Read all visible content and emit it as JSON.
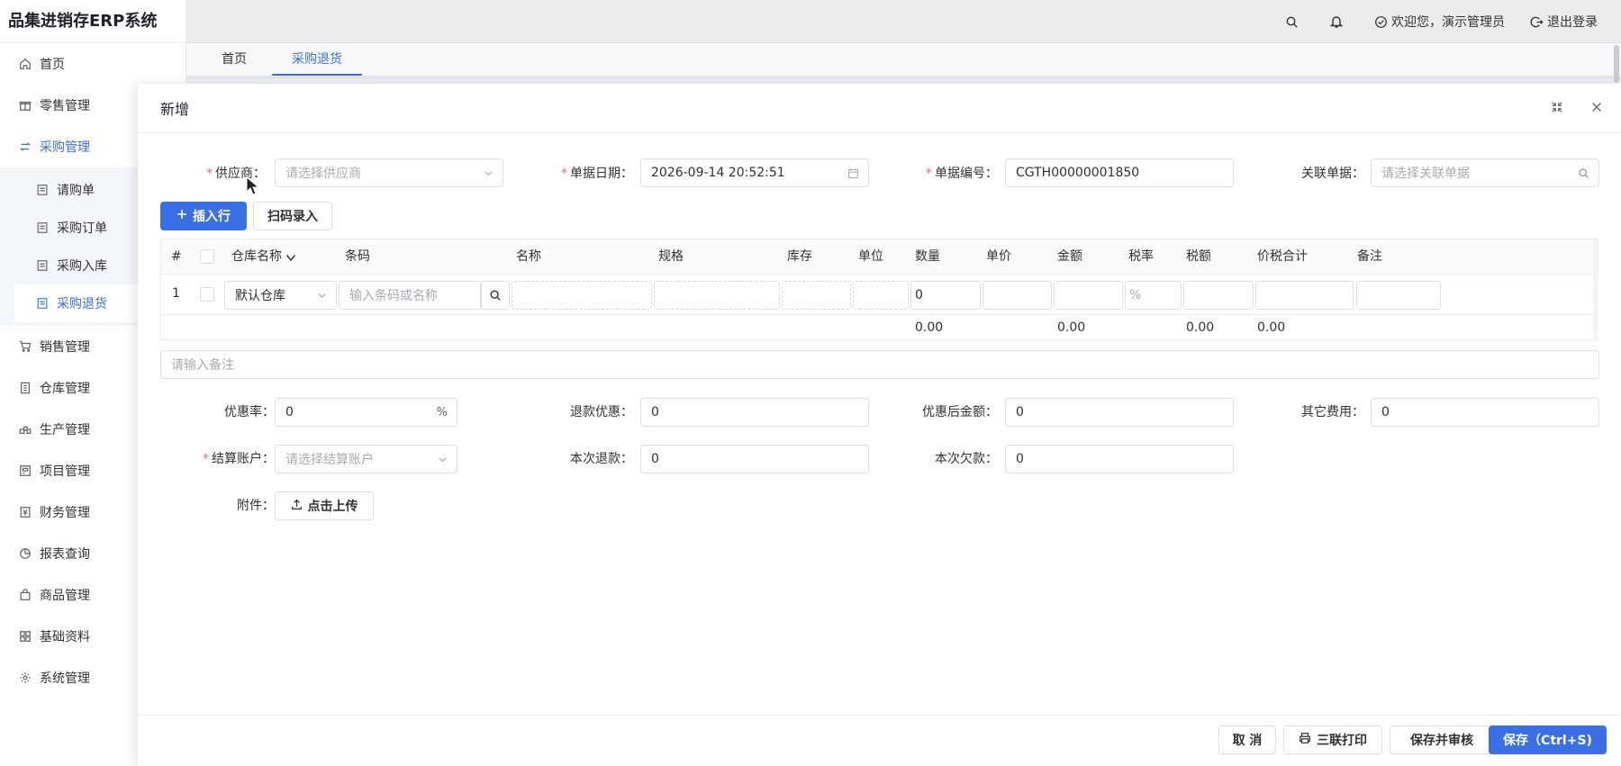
{
  "app": {
    "title": "品集进销存ERP系统"
  },
  "header": {
    "welcome": "欢迎您，演示管理员",
    "logout": "退出登录"
  },
  "sidebar": {
    "items": [
      {
        "label": "首页",
        "icon": "home-icon"
      },
      {
        "label": "零售管理",
        "icon": "gift-icon"
      },
      {
        "label": "采购管理",
        "icon": "swap-icon",
        "open": true,
        "children": [
          {
            "label": "请购单"
          },
          {
            "label": "采购订单"
          },
          {
            "label": "采购入库"
          },
          {
            "label": "采购退货",
            "active": true
          }
        ]
      },
      {
        "label": "销售管理",
        "icon": "cart-icon"
      },
      {
        "label": "仓库管理",
        "icon": "warehouse-icon"
      },
      {
        "label": "生产管理",
        "icon": "production-icon"
      },
      {
        "label": "项目管理",
        "icon": "project-icon"
      },
      {
        "label": "财务管理",
        "icon": "finance-icon"
      },
      {
        "label": "报表查询",
        "icon": "chart-icon"
      },
      {
        "label": "商品管理",
        "icon": "bag-icon"
      },
      {
        "label": "基础资料",
        "icon": "grid-icon"
      },
      {
        "label": "系统管理",
        "icon": "gear-icon"
      }
    ]
  },
  "tabs": [
    {
      "label": "首页"
    },
    {
      "label": "采购退货",
      "active": true
    }
  ],
  "drawer": {
    "title": "新增",
    "supplier": {
      "label": "供应商",
      "placeholder": "请选择供应商"
    },
    "date": {
      "label": "单据日期",
      "value": "2026-09-14 20:52:51"
    },
    "number": {
      "label": "单据编号",
      "value": "CGTH00000001850"
    },
    "related": {
      "label": "关联单据",
      "placeholder": "请选择关联单据"
    },
    "insert_row": "插入行",
    "scan": "扫码录入",
    "table": {
      "columns": [
        "#",
        "仓库名称",
        "条码",
        "名称",
        "规格",
        "库存",
        "单位",
        "数量",
        "单价",
        "金额",
        "税率",
        "税额",
        "价税合计",
        "备注"
      ],
      "row": {
        "index": "1",
        "warehouse": "默认仓库",
        "barcode_placeholder": "输入条码或名称",
        "quantity": "0",
        "tax_placeholder": "%"
      },
      "totals": {
        "quantity": "0.00",
        "amount": "0.00",
        "tax": "0.00",
        "total": "0.00"
      }
    },
    "remark_placeholder": "请输入备注",
    "discount_rate": {
      "label": "优惠率",
      "value": "0",
      "suffix": "%"
    },
    "refund_discount": {
      "label": "退款优惠",
      "value": "0"
    },
    "after_discount": {
      "label": "优惠后金额",
      "value": "0"
    },
    "other_fee": {
      "label": "其它费用",
      "value": "0"
    },
    "account": {
      "label": "结算账户",
      "placeholder": "请选择结算账户"
    },
    "this_refund": {
      "label": "本次退款",
      "value": "0"
    },
    "this_debt": {
      "label": "本次欠款",
      "value": "0"
    },
    "attachment": {
      "label": "附件",
      "button": "点击上传"
    },
    "footer": {
      "cancel": "取 消",
      "print": "三联打印",
      "save_audit": "保存并审核",
      "save": "保存（Ctrl+S)"
    }
  },
  "colors": {
    "primary": "#3a6fe6",
    "required": "#f56c6c"
  }
}
